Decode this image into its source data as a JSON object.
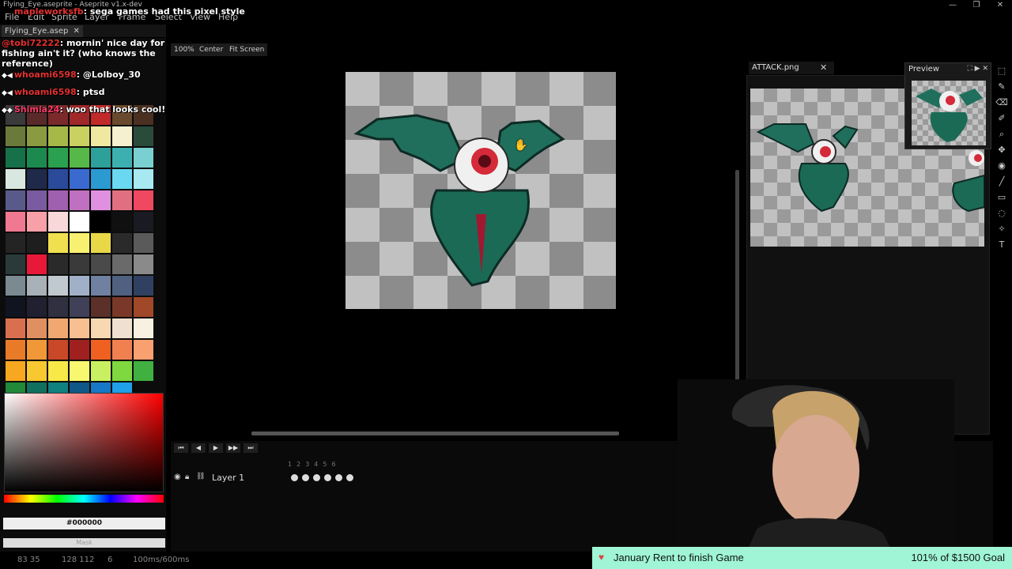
{
  "window": {
    "title": "Flying_Eye.aseprite - Aseprite v1.x-dev",
    "controls": [
      "—",
      "❐",
      "✕"
    ]
  },
  "menu": [
    "File",
    "Edit",
    "Sprite",
    "Layer",
    "Frame",
    "Select",
    "View",
    "Help"
  ],
  "doc_tab": "Flying_Eye.asep",
  "toolbar": {
    "zoom": "100%",
    "center": "Center",
    "fit": "Fit Screen"
  },
  "chat": [
    {
      "user": "mapleworksfb",
      "text": ": sega games had this pixel style"
    },
    {
      "user": "@tobi72222",
      "text": ": mornin' nice day for fishing ain't it? (who knows the reference)"
    },
    {
      "user": "whoami6598",
      "text": ": @Lolboy_30"
    },
    {
      "user": "whoami6598",
      "text": ": ptsd"
    },
    {
      "user": "Shimla24",
      "text": ": woo that looks cool!"
    }
  ],
  "palette": [
    "#3a3a3a",
    "#5a2a2a",
    "#7a2a2a",
    "#a02828",
    "#c22a2a",
    "#6a4a2e",
    "#4a3020",
    "#6b7a3a",
    "#8a9a40",
    "#a6b848",
    "#c9d260",
    "#efe8a0",
    "#f4f0d0",
    "#2a4a3a",
    "#16704a",
    "#1c8a4e",
    "#2aa050",
    "#56b848",
    "#2ea09a",
    "#3cb0b0",
    "#7ad0d0",
    "#d8e8e0",
    "#1f2a4a",
    "#2c4a9a",
    "#3a6ad0",
    "#2a9ad0",
    "#6ad8f0",
    "#a8e8f0",
    "#5a5a8a",
    "#7a5aa0",
    "#a060b0",
    "#c070c0",
    "#e090e0",
    "#e07080",
    "#f04860",
    "#f07890",
    "#f8a0a8",
    "#f8d8d8",
    "#ffffff",
    "#000000",
    "#101010",
    "#1a1a22",
    "#242424",
    "#1e1e1e",
    "#f0e050",
    "#f8f070",
    "#e8d848",
    "#2a2a2a",
    "#5a5a5a",
    "#2a3a3a",
    "#e81838",
    "#2a2a2a",
    "#3a3a3a",
    "#4a4a4a",
    "#6a6a6a",
    "#8a8a8a",
    "#7a8a90",
    "#a8b0b8",
    "#c0c8d0",
    "#a0b0c8",
    "#7080a0",
    "#506080",
    "#304060",
    "#101420",
    "#202030",
    "#303040",
    "#404058",
    "#5a3028",
    "#7a3828",
    "#a04828",
    "#d87050",
    "#e09060",
    "#f0a870",
    "#f8c090",
    "#f8d8b0",
    "#f0e0d0",
    "#f8f0e0",
    "#e87a28",
    "#f09838",
    "#c84828",
    "#a02020",
    "#f06020",
    "#f08050",
    "#f8a070",
    "#f8a820",
    "#f8c830",
    "#f8e848",
    "#f8f870",
    "#c8f060",
    "#80d840",
    "#40b040",
    "#208838",
    "#107060",
    "#108080",
    "#105888",
    "#1878c8",
    "#20a0e8"
  ],
  "color": {
    "hex": "#000000",
    "mask": "Mask"
  },
  "secondary_doc": {
    "tab": "ATTACK.png",
    "close": "✕"
  },
  "preview": {
    "title": "Preview"
  },
  "timeline": {
    "layer": "Layer 1",
    "frames": [
      "1",
      "2",
      "3",
      "4",
      "5",
      "6"
    ]
  },
  "status": {
    "pos": "83 35",
    "size": "128 112",
    "frame": "6",
    "time": "100ms/600ms"
  },
  "goal": {
    "label": "January Rent to finish Game",
    "value": "101% of $1500 Goal"
  }
}
